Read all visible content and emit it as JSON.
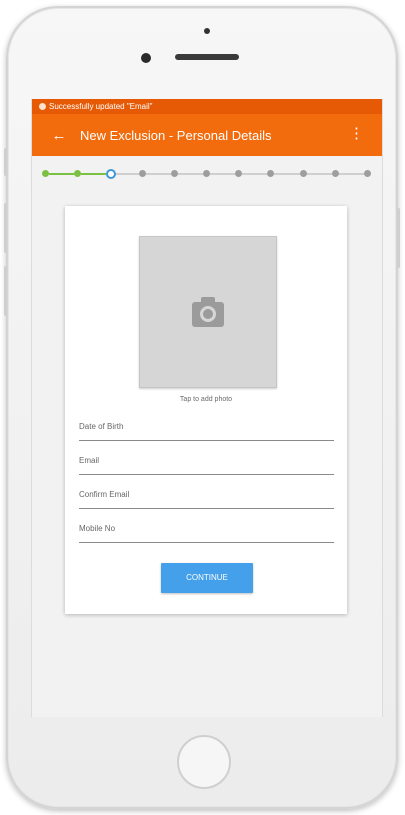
{
  "status_bar": {
    "notification_icon": "notification-icon",
    "text": "Successfully updated \"Email\""
  },
  "app_bar": {
    "back_icon": "arrow-left-icon",
    "back_glyph": "←",
    "title": "New Exclusion - Personal Details",
    "menu_icon": "more-vertical-icon",
    "menu_glyph": "⋮",
    "color": "#f26b0d",
    "status_color": "#e65a06"
  },
  "stepper": {
    "total_steps": 11,
    "completed_steps": 2,
    "current_step": 3,
    "done_color": "#7ac143",
    "current_color": "#3f97d8",
    "pending_color": "#9e9e9e"
  },
  "form": {
    "photo_icon": "camera-icon",
    "photo_hint": "Tap to add photo",
    "fields": [
      {
        "key": "dob",
        "placeholder": "Date of Birth"
      },
      {
        "key": "email",
        "placeholder": "Email"
      },
      {
        "key": "confirm_email",
        "placeholder": "Confirm Email"
      },
      {
        "key": "mobile",
        "placeholder": "Mobile No"
      }
    ],
    "continue_label": "CONTINUE",
    "continue_color": "#44a0ea"
  }
}
